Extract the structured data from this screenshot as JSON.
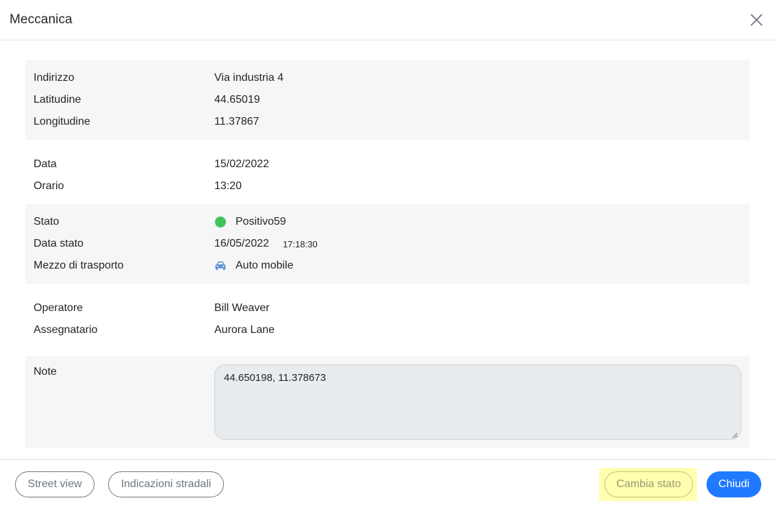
{
  "modal": {
    "title": "Meccanica"
  },
  "location": {
    "address_label": "Indirizzo",
    "address": "Via industria 4",
    "latitude_label": "Latitudine",
    "latitude": "44.65019",
    "longitude_label": "Longitudine",
    "longitude": "11.37867"
  },
  "schedule": {
    "date_label": "Data",
    "date": "15/02/2022",
    "time_label": "Orario",
    "time": "13:20"
  },
  "status": {
    "state_label": "Stato",
    "state": "Positivo59",
    "state_color": "#3fc35a",
    "state_date_label": "Data stato",
    "state_date": "16/05/2022",
    "state_time": "17:18:30",
    "transport_label": "Mezzo di trasporto",
    "transport": "Auto mobile",
    "transport_icon": "car-icon"
  },
  "people": {
    "operator_label": "Operatore",
    "operator": "Bill Weaver",
    "assignee_label": "Assegnatario",
    "assignee": "Aurora Lane"
  },
  "note": {
    "label": "Note",
    "value": "44.650198, 11.378673"
  },
  "footer": {
    "street_view": "Street view",
    "directions": "Indicazioni stradali",
    "change_state": "Cambia stato",
    "close": "Chiudi"
  },
  "colors": {
    "primary": "#1f7aff",
    "highlight": "#ffffb0"
  }
}
